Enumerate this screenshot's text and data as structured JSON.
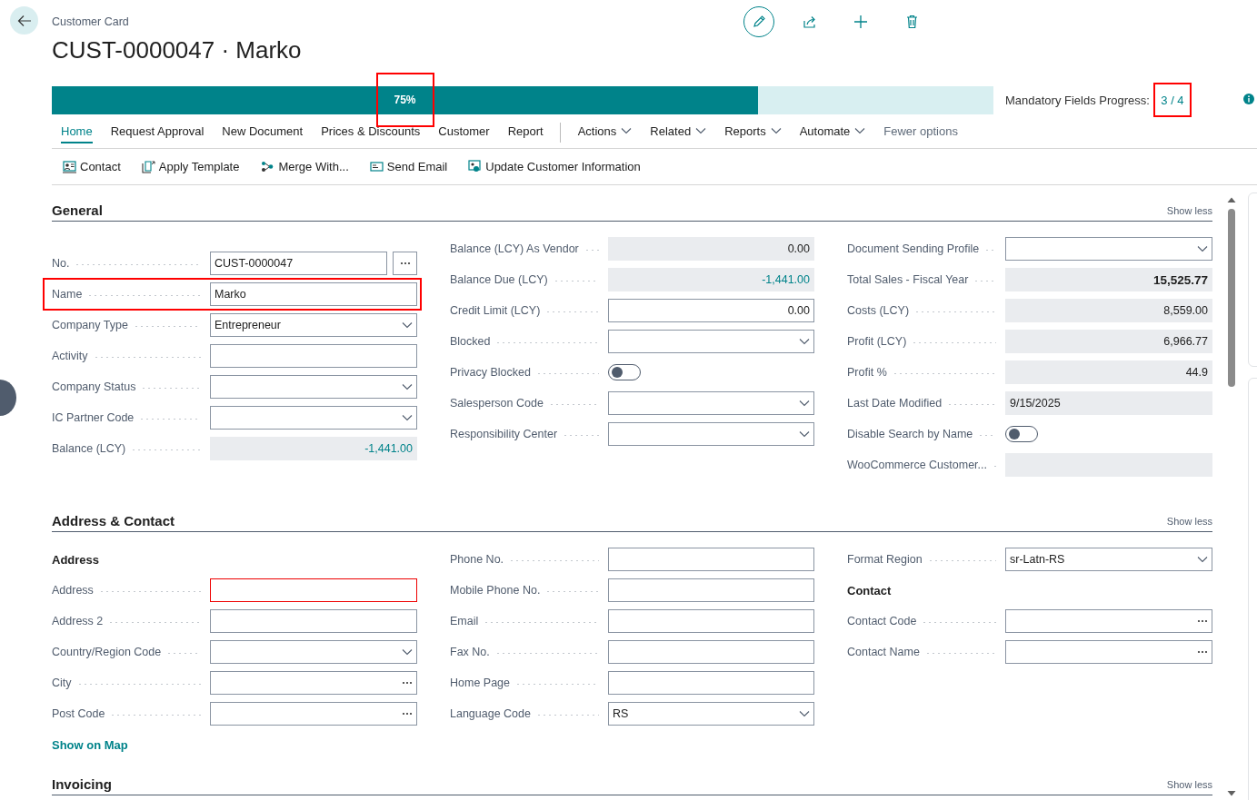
{
  "page": {
    "breadcrumb": "Customer Card",
    "title": "CUST-0000047 · Marko"
  },
  "progress": {
    "level": 0.75,
    "label": "75%",
    "label_highlighted": true,
    "caption": "Mandatory Fields Progress:",
    "count": "3 / 4",
    "count_highlighted": true
  },
  "nav_tabs": [
    {
      "label": "Home",
      "kind": "tab",
      "selected": true
    },
    {
      "label": "Request Approval",
      "kind": "tab",
      "selected": false
    },
    {
      "label": "New Document",
      "kind": "tab",
      "selected": false
    },
    {
      "label": "Prices & Discounts",
      "kind": "tab",
      "selected": false
    },
    {
      "label": "Customer",
      "kind": "tab",
      "selected": false
    },
    {
      "label": "Report",
      "kind": "tab",
      "selected": false
    },
    {
      "label": "Actions",
      "kind": "menu",
      "selected": false
    },
    {
      "label": "Related",
      "kind": "menu",
      "selected": false
    },
    {
      "label": "Reports",
      "kind": "menu",
      "selected": false
    },
    {
      "label": "Automate",
      "kind": "menu",
      "selected": false
    },
    {
      "label": "Fewer options",
      "kind": "link",
      "selected": false
    }
  ],
  "actions": [
    {
      "label": "Contact"
    },
    {
      "label": "Apply Template"
    },
    {
      "label": "Merge With..."
    },
    {
      "label": "Send Email"
    },
    {
      "label": "Update Customer Information"
    }
  ],
  "sections": [
    {
      "title": "General",
      "toggle": "Show less",
      "columns": [
        [
          {
            "label": "No.",
            "kind": "lookup",
            "value": "CUST-0000047",
            "highlighted": false
          },
          {
            "label": "Name",
            "kind": "text",
            "value": "Marko",
            "highlighted": true
          },
          {
            "label": "Company Type",
            "kind": "dropdown",
            "value": "Entrepreneur",
            "highlighted": false
          },
          {
            "label": "Activity",
            "kind": "text",
            "highlighted": false
          },
          {
            "label": "Company Status",
            "kind": "dropdown",
            "highlighted": false
          },
          {
            "label": "IC Partner Code",
            "kind": "dropdown",
            "highlighted": false
          },
          {
            "label": "Balance (LCY)",
            "kind": "drilldown",
            "value": "-1,441.00",
            "highlighted": false
          }
        ],
        [
          {
            "label": "Balance (LCY) As Vendor",
            "kind": "amount",
            "value": "0.00"
          },
          {
            "label": "Balance Due (LCY)",
            "kind": "drilldown",
            "value": "-1,441.00"
          },
          {
            "label": "Credit Limit (LCY)",
            "kind": "number",
            "value": "0.00"
          },
          {
            "label": "Blocked",
            "kind": "dropdown"
          },
          {
            "label": "Privacy Blocked",
            "kind": "toggle",
            "on": false
          },
          {
            "label": "Salesperson Code",
            "kind": "dropdown"
          },
          {
            "label": "Responsibility Center",
            "kind": "dropdown"
          }
        ],
        [
          {
            "label": "Document Sending Profile",
            "kind": "dropdown"
          },
          {
            "label": "Total Sales - Fiscal Year",
            "kind": "total",
            "value": "15,525.77"
          },
          {
            "label": "Costs (LCY)",
            "kind": "amount",
            "value": "8,559.00"
          },
          {
            "label": "Profit (LCY)",
            "kind": "amount",
            "value": "6,966.77"
          },
          {
            "label": "Profit %",
            "kind": "amount",
            "value": "44.9"
          },
          {
            "label": "Last Date Modified",
            "kind": "readonly",
            "value": "9/15/2025"
          },
          {
            "label": "Disable Search by Name",
            "kind": "toggle",
            "on": false
          },
          {
            "label": "WooCommerce Customer...",
            "kind": "readonly"
          }
        ]
      ]
    },
    {
      "title": "Address & Contact",
      "toggle": "Show less",
      "columns": [
        [
          {
            "label": "Address",
            "kind": "heading"
          },
          {
            "label": "Address",
            "kind": "missing"
          },
          {
            "label": "Address 2",
            "kind": "text"
          },
          {
            "label": "Country/Region Code",
            "kind": "dropdown"
          },
          {
            "label": "City",
            "kind": "assist"
          },
          {
            "label": "Post Code",
            "kind": "assist"
          },
          {
            "label": "Show on Map",
            "kind": "link"
          }
        ],
        [
          {
            "label": "Phone No.",
            "kind": "text"
          },
          {
            "label": "Mobile Phone No.",
            "kind": "text"
          },
          {
            "label": "Email",
            "kind": "text"
          },
          {
            "label": "Fax No.",
            "kind": "text"
          },
          {
            "label": "Home Page",
            "kind": "text"
          },
          {
            "label": "Language Code",
            "kind": "dropdown",
            "value": "RS"
          }
        ],
        [
          {
            "label": "Format Region",
            "kind": "dropdown",
            "value": "sr-Latn-RS"
          },
          {
            "label": "Contact",
            "kind": "heading"
          },
          {
            "label": "Contact Code",
            "kind": "assist"
          },
          {
            "label": "Contact Name",
            "kind": "assist"
          }
        ]
      ]
    },
    {
      "title": "Invoicing",
      "toggle": "Show less"
    }
  ]
}
